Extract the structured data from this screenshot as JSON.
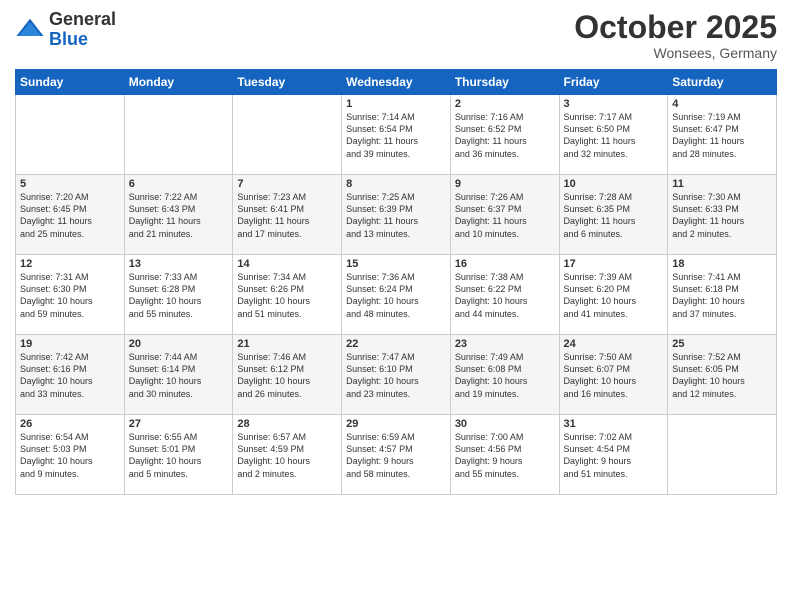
{
  "header": {
    "logo_general": "General",
    "logo_blue": "Blue",
    "month_title": "October 2025",
    "location": "Wonsees, Germany"
  },
  "days_of_week": [
    "Sunday",
    "Monday",
    "Tuesday",
    "Wednesday",
    "Thursday",
    "Friday",
    "Saturday"
  ],
  "weeks": [
    [
      {
        "day": "",
        "info": ""
      },
      {
        "day": "",
        "info": ""
      },
      {
        "day": "",
        "info": ""
      },
      {
        "day": "1",
        "info": "Sunrise: 7:14 AM\nSunset: 6:54 PM\nDaylight: 11 hours\nand 39 minutes."
      },
      {
        "day": "2",
        "info": "Sunrise: 7:16 AM\nSunset: 6:52 PM\nDaylight: 11 hours\nand 36 minutes."
      },
      {
        "day": "3",
        "info": "Sunrise: 7:17 AM\nSunset: 6:50 PM\nDaylight: 11 hours\nand 32 minutes."
      },
      {
        "day": "4",
        "info": "Sunrise: 7:19 AM\nSunset: 6:47 PM\nDaylight: 11 hours\nand 28 minutes."
      }
    ],
    [
      {
        "day": "5",
        "info": "Sunrise: 7:20 AM\nSunset: 6:45 PM\nDaylight: 11 hours\nand 25 minutes."
      },
      {
        "day": "6",
        "info": "Sunrise: 7:22 AM\nSunset: 6:43 PM\nDaylight: 11 hours\nand 21 minutes."
      },
      {
        "day": "7",
        "info": "Sunrise: 7:23 AM\nSunset: 6:41 PM\nDaylight: 11 hours\nand 17 minutes."
      },
      {
        "day": "8",
        "info": "Sunrise: 7:25 AM\nSunset: 6:39 PM\nDaylight: 11 hours\nand 13 minutes."
      },
      {
        "day": "9",
        "info": "Sunrise: 7:26 AM\nSunset: 6:37 PM\nDaylight: 11 hours\nand 10 minutes."
      },
      {
        "day": "10",
        "info": "Sunrise: 7:28 AM\nSunset: 6:35 PM\nDaylight: 11 hours\nand 6 minutes."
      },
      {
        "day": "11",
        "info": "Sunrise: 7:30 AM\nSunset: 6:33 PM\nDaylight: 11 hours\nand 2 minutes."
      }
    ],
    [
      {
        "day": "12",
        "info": "Sunrise: 7:31 AM\nSunset: 6:30 PM\nDaylight: 10 hours\nand 59 minutes."
      },
      {
        "day": "13",
        "info": "Sunrise: 7:33 AM\nSunset: 6:28 PM\nDaylight: 10 hours\nand 55 minutes."
      },
      {
        "day": "14",
        "info": "Sunrise: 7:34 AM\nSunset: 6:26 PM\nDaylight: 10 hours\nand 51 minutes."
      },
      {
        "day": "15",
        "info": "Sunrise: 7:36 AM\nSunset: 6:24 PM\nDaylight: 10 hours\nand 48 minutes."
      },
      {
        "day": "16",
        "info": "Sunrise: 7:38 AM\nSunset: 6:22 PM\nDaylight: 10 hours\nand 44 minutes."
      },
      {
        "day": "17",
        "info": "Sunrise: 7:39 AM\nSunset: 6:20 PM\nDaylight: 10 hours\nand 41 minutes."
      },
      {
        "day": "18",
        "info": "Sunrise: 7:41 AM\nSunset: 6:18 PM\nDaylight: 10 hours\nand 37 minutes."
      }
    ],
    [
      {
        "day": "19",
        "info": "Sunrise: 7:42 AM\nSunset: 6:16 PM\nDaylight: 10 hours\nand 33 minutes."
      },
      {
        "day": "20",
        "info": "Sunrise: 7:44 AM\nSunset: 6:14 PM\nDaylight: 10 hours\nand 30 minutes."
      },
      {
        "day": "21",
        "info": "Sunrise: 7:46 AM\nSunset: 6:12 PM\nDaylight: 10 hours\nand 26 minutes."
      },
      {
        "day": "22",
        "info": "Sunrise: 7:47 AM\nSunset: 6:10 PM\nDaylight: 10 hours\nand 23 minutes."
      },
      {
        "day": "23",
        "info": "Sunrise: 7:49 AM\nSunset: 6:08 PM\nDaylight: 10 hours\nand 19 minutes."
      },
      {
        "day": "24",
        "info": "Sunrise: 7:50 AM\nSunset: 6:07 PM\nDaylight: 10 hours\nand 16 minutes."
      },
      {
        "day": "25",
        "info": "Sunrise: 7:52 AM\nSunset: 6:05 PM\nDaylight: 10 hours\nand 12 minutes."
      }
    ],
    [
      {
        "day": "26",
        "info": "Sunrise: 6:54 AM\nSunset: 5:03 PM\nDaylight: 10 hours\nand 9 minutes."
      },
      {
        "day": "27",
        "info": "Sunrise: 6:55 AM\nSunset: 5:01 PM\nDaylight: 10 hours\nand 5 minutes."
      },
      {
        "day": "28",
        "info": "Sunrise: 6:57 AM\nSunset: 4:59 PM\nDaylight: 10 hours\nand 2 minutes."
      },
      {
        "day": "29",
        "info": "Sunrise: 6:59 AM\nSunset: 4:57 PM\nDaylight: 9 hours\nand 58 minutes."
      },
      {
        "day": "30",
        "info": "Sunrise: 7:00 AM\nSunset: 4:56 PM\nDaylight: 9 hours\nand 55 minutes."
      },
      {
        "day": "31",
        "info": "Sunrise: 7:02 AM\nSunset: 4:54 PM\nDaylight: 9 hours\nand 51 minutes."
      },
      {
        "day": "",
        "info": ""
      }
    ]
  ]
}
